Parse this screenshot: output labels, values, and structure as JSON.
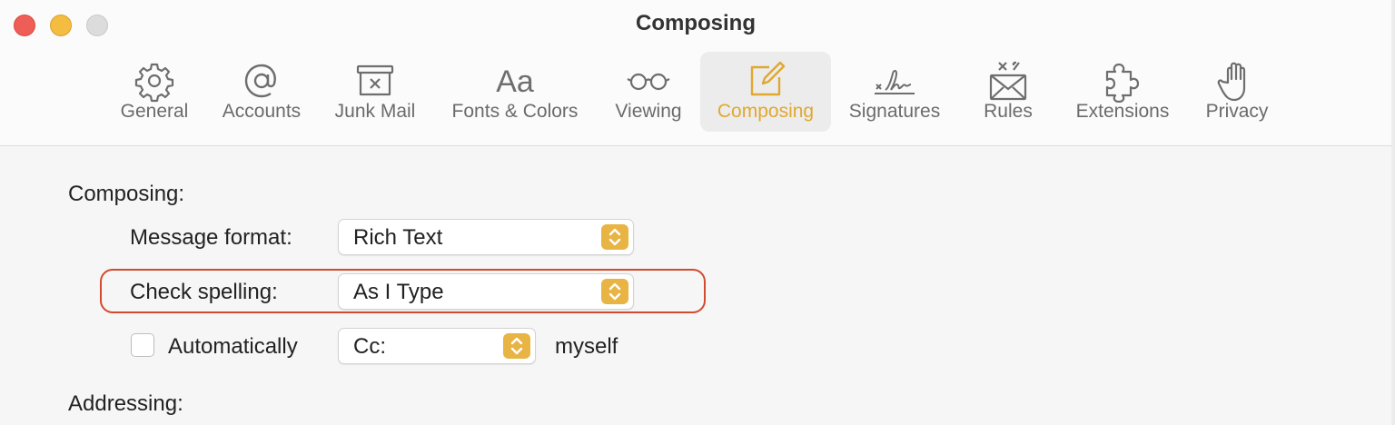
{
  "window": {
    "title": "Composing"
  },
  "toolbar": {
    "items": [
      {
        "label": "General",
        "icon": "gear-icon",
        "active": false
      },
      {
        "label": "Accounts",
        "icon": "at-sign-icon",
        "active": false
      },
      {
        "label": "Junk Mail",
        "icon": "junk-mail-icon",
        "active": false
      },
      {
        "label": "Fonts & Colors",
        "icon": "fonts-icon",
        "active": false
      },
      {
        "label": "Viewing",
        "icon": "glasses-icon",
        "active": false
      },
      {
        "label": "Composing",
        "icon": "compose-icon",
        "active": true
      },
      {
        "label": "Signatures",
        "icon": "signature-icon",
        "active": false
      },
      {
        "label": "Rules",
        "icon": "rules-icon",
        "active": false
      },
      {
        "label": "Extensions",
        "icon": "puzzle-icon",
        "active": false
      },
      {
        "label": "Privacy",
        "icon": "hand-icon",
        "active": false
      }
    ],
    "active_color": "#e0a830"
  },
  "composing": {
    "section_label": "Composing:",
    "message_format": {
      "label": "Message format:",
      "value": "Rich Text"
    },
    "check_spelling": {
      "label": "Check spelling:",
      "value": "As I Type"
    },
    "auto_cc": {
      "label": "Automatically",
      "checked": false,
      "value": "Cc:",
      "suffix": "myself"
    }
  },
  "addressing": {
    "section_label": "Addressing:"
  },
  "colors": {
    "accent": "#e8b444",
    "highlight": "#d24a2f"
  }
}
